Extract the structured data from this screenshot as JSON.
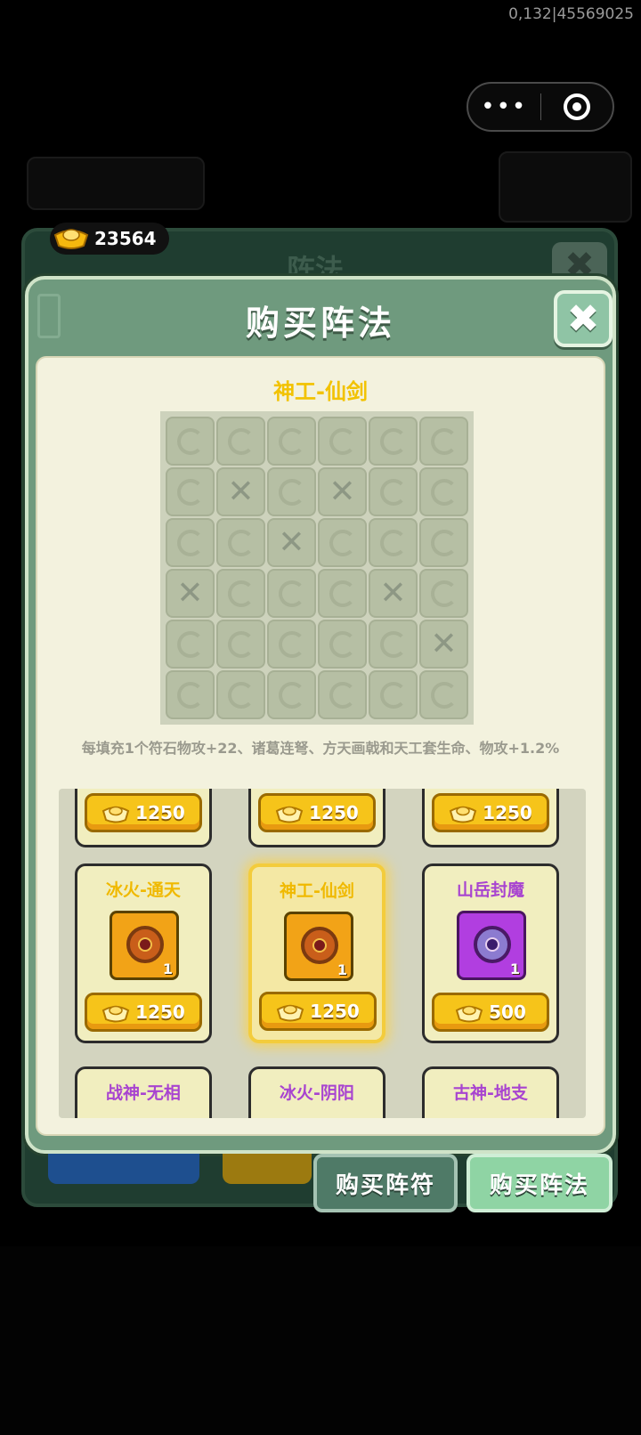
{
  "debug_overlay": "0,132|45569025",
  "capsule": {
    "more_glyph": "•••",
    "target_icon": "target-icon"
  },
  "currency": {
    "amount": "23564",
    "icon": "gold-ingot-icon"
  },
  "back_panel": {
    "title": "阵法",
    "close_glyph": "✖"
  },
  "modal": {
    "title": "购买阵法",
    "close_glyph": "✖",
    "formation_name": "神工-仙剑",
    "grid": {
      "rows": 6,
      "cols": 6,
      "blocked_cells": [
        [
          1,
          1
        ],
        [
          1,
          3
        ],
        [
          2,
          2
        ],
        [
          3,
          0
        ],
        [
          3,
          4
        ],
        [
          4,
          5
        ]
      ]
    },
    "description": "每填充1个符石物攻+22、诸葛连弩、方天画戟和天工套生命、物攻+1.2%"
  },
  "shop": {
    "top_row_prices": [
      "1250",
      "1250",
      "1250"
    ],
    "cards": [
      {
        "name": "冰火-通天",
        "color": "#f0b900",
        "qty": "1",
        "price": "1250",
        "selected": false
      },
      {
        "name": "神工-仙剑",
        "color": "#f0b900",
        "qty": "1",
        "price": "1250",
        "selected": true
      },
      {
        "name": "山岳封魔",
        "color": "#a844d0",
        "qty": "1",
        "price": "500",
        "selected": false
      }
    ],
    "bottom_row_names": [
      "战神-无相",
      "冰火-阴阳",
      "古神-地支"
    ]
  },
  "tabs": {
    "buy_rune": "购买阵符",
    "buy_formation": "购买阵法"
  },
  "colors": {
    "accent_gold": "#f6c41a",
    "panel_green": "#6f9a7e",
    "purple": "#a844d0"
  }
}
